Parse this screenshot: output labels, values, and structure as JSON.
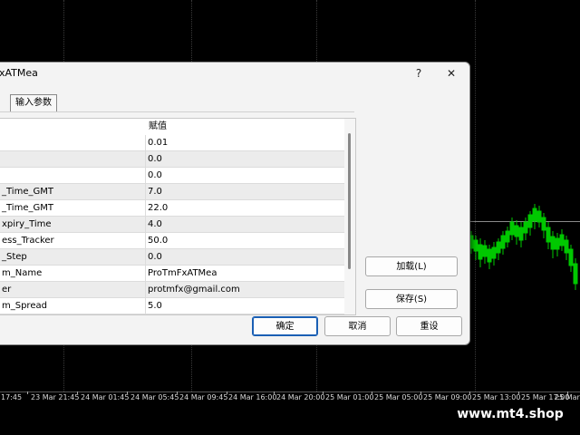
{
  "dialog": {
    "title": "xATMea",
    "help_label": "?",
    "close_label": "✕",
    "tab_label": "输入参数",
    "column_value_header": "赋值",
    "rows": [
      {
        "name": "",
        "value": "0.01"
      },
      {
        "name": "",
        "value": "0.0"
      },
      {
        "name": "",
        "value": "0.0"
      },
      {
        "name": "_Time_GMT",
        "value": "7.0"
      },
      {
        "name": "_Time_GMT",
        "value": "22.0"
      },
      {
        "name": "xpiry_Time",
        "value": "4.0"
      },
      {
        "name": "ess_Tracker",
        "value": "50.0"
      },
      {
        "name": "_Step",
        "value": "0.0"
      },
      {
        "name": "m_Name",
        "value": "ProTmFxATMea"
      },
      {
        "name": "er",
        "value": "protmfx@gmail.com"
      },
      {
        "name": "m_Spread",
        "value": "5.0"
      }
    ],
    "load_button": "加载(L)",
    "save_button": "保存(S)",
    "ok_button": "确定",
    "cancel_button": "取消",
    "reset_button": "重设"
  },
  "chart": {
    "time_labels": [
      "17:45",
      "23 Mar 21:45",
      "24 Mar 01:45",
      "24 Mar 05:45",
      "24 Mar 09:45",
      "24 Mar 16:00",
      "24 Mar 20:00",
      "25 Mar 01:00",
      "25 Mar 05:00",
      "25 Mar 09:00",
      "25 Mar 13:00",
      "25 Mar 17:00",
      "25 Mar"
    ],
    "candle_color": "#00c800",
    "watermark": "www.mt4.shop"
  }
}
